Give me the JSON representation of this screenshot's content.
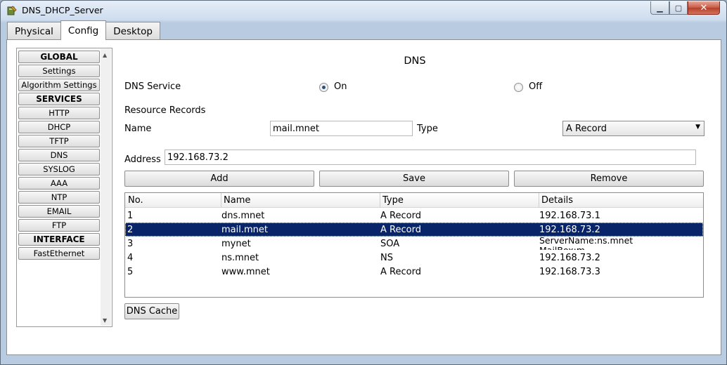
{
  "window": {
    "title": "DNS_DHCP_Server"
  },
  "tabs": [
    {
      "label": "Physical",
      "active": false
    },
    {
      "label": "Config",
      "active": true
    },
    {
      "label": "Desktop",
      "active": false
    }
  ],
  "nav": {
    "items": [
      {
        "label": "GLOBAL",
        "header": true
      },
      {
        "label": "Settings"
      },
      {
        "label": "Algorithm Settings"
      },
      {
        "label": "SERVICES",
        "header": true
      },
      {
        "label": "HTTP"
      },
      {
        "label": "DHCP"
      },
      {
        "label": "TFTP"
      },
      {
        "label": "DNS"
      },
      {
        "label": "SYSLOG"
      },
      {
        "label": "AAA"
      },
      {
        "label": "NTP"
      },
      {
        "label": "EMAIL"
      },
      {
        "label": "FTP"
      },
      {
        "label": "INTERFACE",
        "header": true
      },
      {
        "label": "FastEthernet"
      }
    ]
  },
  "dns": {
    "heading": "DNS",
    "service_label": "DNS Service",
    "on_label": "On",
    "off_label": "Off",
    "selected": "On",
    "resource_records_label": "Resource Records",
    "name_label": "Name",
    "name_value": "mail.mnet",
    "type_label": "Type",
    "type_value": "A Record",
    "address_label": "Address",
    "address_value": "192.168.73.2",
    "add_label": "Add",
    "save_label": "Save",
    "remove_label": "Remove",
    "cache_label": "DNS Cache"
  },
  "table": {
    "headers": [
      "No.",
      "Name",
      "Type",
      "Details"
    ],
    "rows": [
      {
        "no": "1",
        "name": "dns.mnet",
        "type": "A Record",
        "details": "192.168.73.1",
        "selected": false
      },
      {
        "no": "2",
        "name": "mail.mnet",
        "type": "A Record",
        "details": "192.168.73.2",
        "selected": true
      },
      {
        "no": "3",
        "name": "mynet",
        "type": "SOA",
        "details": "ServerName:ns.mnet MailBox:m",
        "selected": false
      },
      {
        "no": "4",
        "name": "ns.mnet",
        "type": "NS",
        "details": "192.168.73.2",
        "selected": false
      },
      {
        "no": "5",
        "name": "www.mnet",
        "type": "A Record",
        "details": "192.168.73.3",
        "selected": false
      }
    ]
  },
  "colors": {
    "selection": "#0a246a",
    "radio_dot": "#2b4f7a"
  }
}
